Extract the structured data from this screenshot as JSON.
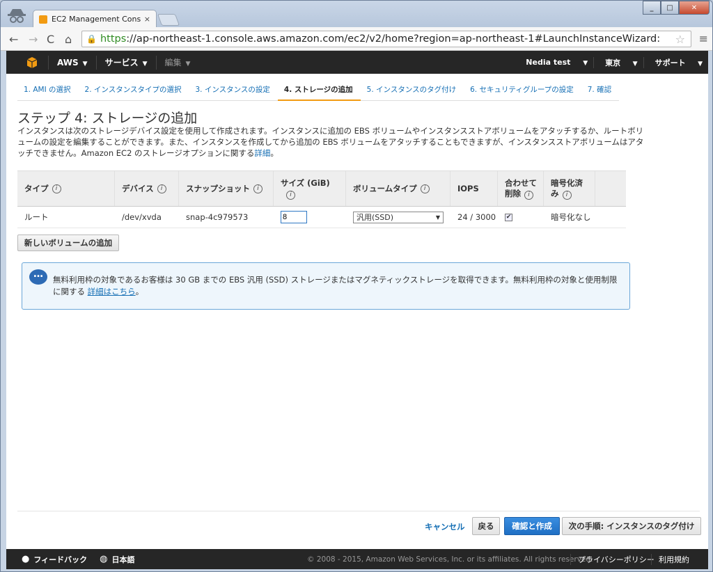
{
  "browser": {
    "tab_title": "EC2 Management Cons",
    "tab_close": "×",
    "url_https": "https",
    "url_rest": "://ap-northeast-1.console.aws.amazon.com/ec2/v2/home?region=ap-northeast-1#LaunchInstanceWizard:",
    "win_min": "_",
    "win_max": "□",
    "win_close": "✕"
  },
  "aws_nav": {
    "brand": "AWS",
    "services": "サービス",
    "edit": "編集",
    "account": "Nedia test",
    "region": "東京",
    "support": "サポート"
  },
  "wizard_steps": [
    {
      "label": "1. AMI の選択",
      "active": false
    },
    {
      "label": "2. インスタンスタイプの選択",
      "active": false
    },
    {
      "label": "3. インスタンスの設定",
      "active": false
    },
    {
      "label": "4. ストレージの追加",
      "active": true
    },
    {
      "label": "5. インスタンスのタグ付け",
      "active": false
    },
    {
      "label": "6. セキュリティグループの設定",
      "active": false
    },
    {
      "label": "7. 確認",
      "active": false
    }
  ],
  "page": {
    "title": "ステップ 4: ストレージの追加",
    "desc_1": "インスタンスは次のストレージデバイス設定を使用して作成されます。インスタンスに追加の EBS ボリュームやインスタンスストアボリュームをアタッチするか、ルートボリュームの設定を編集することができます。また、インスタンスを作成してから追加の EBS ボリュームをアタッチすることもできますが、インスタンスストアボリュームはアタッチできません。Amazon EC2 のストレージオプションに関する",
    "desc_link": "詳細",
    "desc_end": "。"
  },
  "table": {
    "headers": {
      "type": "タイプ",
      "device": "デバイス",
      "snapshot": "スナップショット",
      "size_1": "サイズ (GiB)",
      "voltype": "ボリュームタイプ",
      "iops": "IOPS",
      "delete_1": "合わせて",
      "delete_2": "削除",
      "encrypted_1": "暗号化済",
      "encrypted_2": "み"
    },
    "row": {
      "type": "ルート",
      "device": "/dev/xvda",
      "snapshot": "snap-4c979573",
      "size": "8",
      "voltype": "汎用(SSD)",
      "iops": "24 / 3000",
      "delete_checked": "✔",
      "encrypted": "暗号化なし"
    }
  },
  "add_volume_button": "新しいボリュームの追加",
  "info": {
    "text": "無料利用枠の対象であるお客様は 30 GB までの EBS 汎用 (SSD) ストレージまたはマグネティックストレージを取得できます。無料利用枠の対象と使用制限に関する",
    "link": "詳細はこちら",
    "end": "。"
  },
  "footer_buttons": {
    "cancel": "キャンセル",
    "back": "戻る",
    "review": "確認と作成",
    "next": "次の手順: インスタンスのタグ付け"
  },
  "bottom_bar": {
    "feedback": "フィードバック",
    "language": "日本語",
    "copyright": "© 2008 - 2015, Amazon Web Services, Inc. or its affiliates. All rights reserved.",
    "privacy": "プライバシーポリシー",
    "terms": "利用規約"
  },
  "colors": {
    "aws_bar": "#262626",
    "link": "#146eb4",
    "primary_button": "#1f6fc4",
    "active_step_underline": "#f29b12"
  }
}
